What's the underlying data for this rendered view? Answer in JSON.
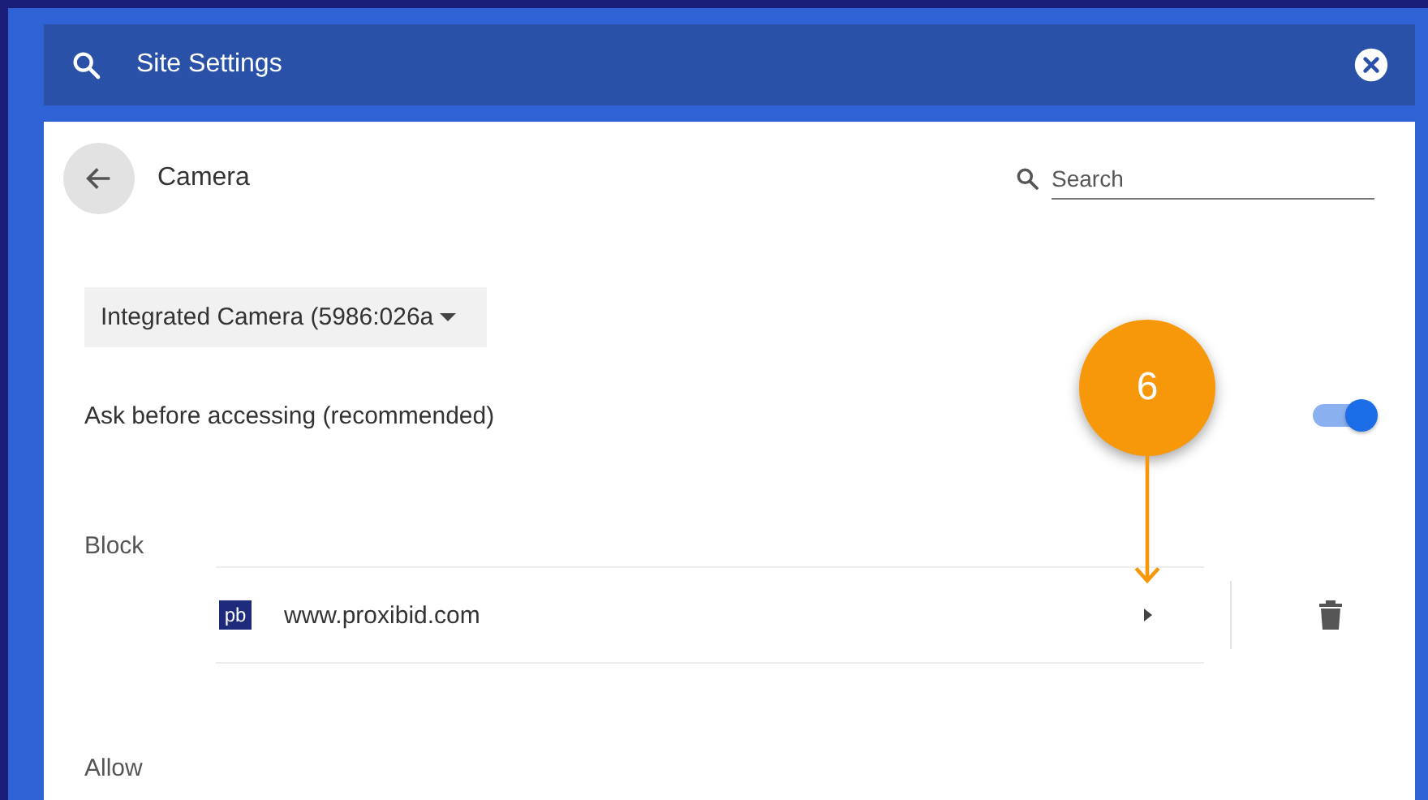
{
  "header": {
    "title": "Site Settings"
  },
  "page": {
    "title": "Camera",
    "search": {
      "placeholder": "Search"
    }
  },
  "device_dropdown": {
    "value": "Integrated Camera (5986:026a"
  },
  "ask_setting": {
    "label": "Ask before accessing (recommended)",
    "on": true
  },
  "sections": [
    {
      "title": "Block",
      "sites": [
        {
          "favicon_text": "pb",
          "url": "www.proxibid.com"
        }
      ]
    },
    {
      "title": "Allow"
    }
  ],
  "callout": {
    "number": "6"
  }
}
